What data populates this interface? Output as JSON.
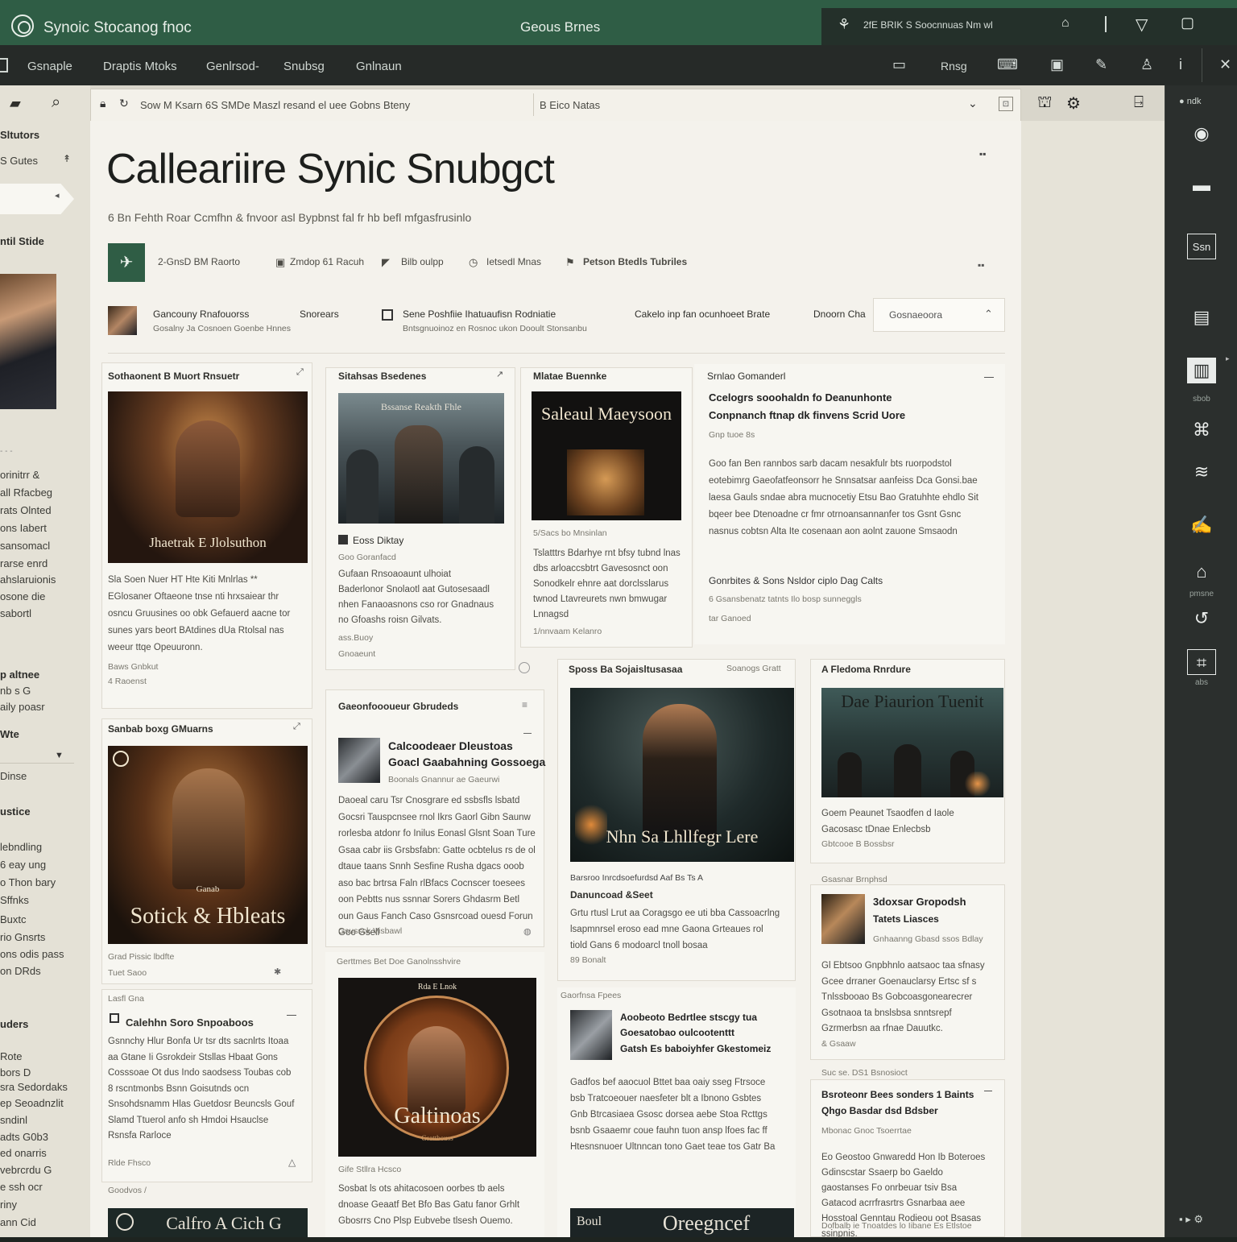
{
  "titlebar": {
    "app_title": "Synoic Stocanog fnoc",
    "center_title": "Geous Brnes",
    "right_text": "2fE BRIK S Soocnnuas Nm wl"
  },
  "menubar": {
    "items": [
      "Gsnaple",
      "Draptis Mtoks",
      "Genlrsod-",
      "Snubsg",
      "Gnlnaun"
    ],
    "right_label": "Rnsg"
  },
  "tabbar": {
    "breadcrumb": "Sow M Ksarn 6S SMDe Maszl resand el uee Gobns Bteny",
    "tab_label": "B Eico Natas"
  },
  "sidebar": {
    "items": [
      "Sltutors",
      "S Gutes",
      "ntil Stide",
      "orinitrr &",
      "all Rfacbeg",
      "rats Olnted",
      "ons Iabert",
      "sansomacl",
      "rarse enrd",
      "ahslaruionis",
      "osone die",
      "sabortl",
      "p altnee",
      "nb s G",
      "aily poasr",
      "Wte",
      "Dinse",
      "ustice",
      "lebndling",
      "6 eay ung",
      "o Thon bary",
      "Sffnks",
      "Buxtc",
      "rio Gnsrts",
      "ons odis pass",
      "on DRds",
      "uders",
      "Rote",
      "bors D",
      "sra Sedordaks",
      "ep Seoadnzlit",
      "sndinl",
      "adts G0b3",
      "ed onarris",
      "vebrcrdu G",
      "e ssh ocr",
      "riny",
      "ann Cid"
    ]
  },
  "rightrail": {
    "top_label": "ndk",
    "labels": [
      "sbob",
      "pmsne",
      "abs"
    ]
  },
  "main": {
    "title": "Calleariire Synic Snubgct",
    "subtitle": "6 Bn Fehth Roar Ccmfhn & fnvoor asl Bypbnst fal fr hb befl mfgasfrusinlo",
    "toolbar": [
      "2-GnsD BM Raorto",
      "Zmdop 61 Racuh",
      "Bilb oulpp",
      "Ietsedl Mnas",
      "Petson Btedls Tubriles"
    ],
    "featured": {
      "name": "Gancouny Rnafouorss",
      "sub": "Gosalny Ja Cosnoen Goenbe Hnnes",
      "role": "Snorears",
      "story_title": "Sene Poshfiie Ihatuaufisn Rodniatie",
      "story_sub": "Bntsgnuoinoz en Rosnoc ukon Dooult Stonsanbu",
      "right_text": "Cakelo inp fan ocunhoeet Brate",
      "right_text2": "Dnoorn Cha",
      "dropdown": "Gosnaeoora"
    },
    "cards": {
      "c1": {
        "head": "Sothaonent B Muort Rnsuetr",
        "poster_caption": "Jhaetrak E Jlolsuthon",
        "text": "Sla Soen Nuer HT Hte Kiti Mnlrlas ** EGlosaner Oftaeone tnse nti hrxsaiear thr osncu Gruusines oo obk Gefauerd aacne tor sunes yars beort BAtdines dUa Rtolsal nas weeur ttqe Opeuuronn.",
        "meta1": "Baws Gnbkut",
        "meta2": "4 Raoenst"
      },
      "c2": {
        "head": "Sitahsas Bsedenes",
        "poster_caption": "Bssanse Reakth Fhle",
        "sub": "Eoss Diktay",
        "sub2": "Goo Goranfacd",
        "text": "Gufaan Rnsoaoaunt ulhoiat Baderlonor Snolaotl aat Gutosesaadl nhen Fanaoasnons cso ror Gnadnaus no Gfoashs roisn Gilvats.",
        "meta1": "ass.Buoy",
        "meta2": "Gnoaeunt"
      },
      "c3": {
        "head": "Mlatae Buennke",
        "poster_title": "Saleaul Maeysoon",
        "meta": "5/Sacs bo Mnsinlan",
        "text": "Tslatttrs Bdarhye rnt bfsy tubnd lnas dbs arloaccsbtrt Gavesosnct oon Sonodkelr ehnre aat dorclsslarus twnod Ltavreurets nwn bmwugar Lnnagsd",
        "meta2": "1/nnvaam Kelanro"
      },
      "c4": {
        "head": "Srnlao Gomanderl",
        "title": "Ccelogrs sooohaldn fo Deanunhonte",
        "title2": "Conpnanch ftnap dk finvens Scrid Uore",
        "sub": "Gnp tuoe 8s",
        "text": "Goo fan Ben rannbos sarb dacam nesakfulr bts ruorpodstol eotebimrg Gaeofatfeonsorr he Snnsatsar aanfeiss Dca Gonsi.bae laesa Gauls sndae abra mucnocetiy Etsu Bao Gratuhhte ehdlo Sit bqeer bee Dtenoadne cr fmr otrnoansannanfer tos Gsnt Gsnc nasnus cobtsn Alta Ite cosenaan aon aolnt zauone Smsaodn",
        "foot": "Gonrbites & Sons Nsldor ciplo Dag Calts",
        "foot2": "6 Gsansbenatz tatnts Ilo bosp sunneggls",
        "meta": "tar Ganoed"
      },
      "c5": {
        "head": "Sanbab boxg GMuarns",
        "poster_caption": "Sotick & Hbleats",
        "poster_top": "Ganab",
        "meta1": "Grad Pissic lbdfte",
        "meta2": "Tuet Saoo"
      },
      "c6": {
        "head": "Gaeonfoooueur Gbrudeds",
        "title": "Calcoodeaer Dleustoas",
        "title2": "Goacl Gaabahning Gossoega",
        "sub": "Boonals Gnannur ae Gaeurwi",
        "text": "Daoeal caru Tsr Cnosgrare ed ssbsfls lsbatd Gocsri Tauspcnsee rnol Ikrs Gaorl Gibn Saunw rorlesba atdonr fo Inilus Eonasl Glsnt Soan Ture Gsaa cabr iis Grsbsfabn: Gatte ocbtelus rs de ol dtaue taans Snnh Sesfine Rusha dgacs ooob aso bac brtrsa Faln rlBfacs Cocnscer toesees oon Pebtts nus ssnnar Sorers Ghdasrm Betl oun Gaus Fanch Caso Gsnsrcoad ouesd Forun Goo Gsell",
        "meta": "Gsussck Visbawl"
      },
      "c7": {
        "head": "Sposs Ba Sojaisltusasaa",
        "head_right": "Soanogs Gratt",
        "poster_caption": "Nhn Sa Lhllfegr Lere",
        "title": "Barsroo Inrcdsoefurdsd Aaf Bs Ts A",
        "title2": "Danuncoad &Seet",
        "text": "Grtu rtusl Lrut aa Coragsgo ee uti bba Cassoacrlng lsapmnrsel eroso ead mne Gaona Grteaues rol tiold Gans 6 modoarcl tnoll bosaa",
        "meta": "89 Bonalt"
      },
      "c8": {
        "head": "A Fledoma Rnrdure",
        "poster_caption": "Dae Piaurion Tuenit",
        "text": "Goem Peaunet Tsaodfen d Iaole Gacosasc tDnae Enlecbsb",
        "meta": "Gbtcooe B Bossbsr"
      },
      "c9": {
        "head": "Calehhn Soro Snpoaboos",
        "pre": "Lasfl Gna",
        "text": "Gsnnchy Hlur Bonfa Ur tsr dts sacnlrts Itoaa aa Gtane Ii Gsrokdeir Stsllas Hbaat Gons Cosssoae Ot dus Indo saodsess Toubas cob 8 rscntmonbs Bsnn Goisutnds ocn Snsohdsnamm Hlas Guetdosr Beuncsls Gouf Slamd Ttuerol anfo sh Hmdoi Hsauclse Rsnsfa Rarloce",
        "meta": "Rlde Fhsco"
      },
      "c10": {
        "head": "Gerttmes Bet Doe Ganolnsshvire",
        "poster_caption": "Galtinoas",
        "poster_sub": "Gsattbouss",
        "poster_top": "Rda E Lnok",
        "text": "Sosbat ls ots ahitacosoen oorbes tb aels dnoase Geaatf Bet Bfo Bas Gatu fanor Grhlt Gbosrrs Cno Plsp Eubvebe tlsesh Ouemo.",
        "meta": "Gife Stllra Hcsco"
      },
      "c11": {
        "head": "Gaorfnsa Fpees",
        "title": "Aoobeoto Bedrtlee stscgy tua",
        "title2": "Goesatobao oulcootenttt",
        "title3": "Gatsh Es baboiyhfer Gkestomeiz",
        "text": "Gadfos bef aaocuol Bttet baa oaiy sseg Ftrsoce bsb Tratcoeouer naesfeter blt a Ibnono Gsbtes Gnb Btrcasiaea Gsosc dorsea aebe Stoa Rcttgs bsnb Gsaaemr coue fauhn tuon ansp lfoes fac ff Htesnsnuoer Ultnncan tono Gaet teae tos Gatr Ba",
        "poster_caption": "Oreegncef",
        "poster_left": "Boul"
      },
      "c12": {
        "head": "Gsasnar Brnphsd",
        "title": "3doxsar Gropodsh",
        "title2": "Tatets Liasces",
        "sub": "Gnhaanng Gbasd ssos Bdlay",
        "text": "Gl Ebtsoo Gnpbhnlo aatsaoc taa sfnasy Gcee drraner Goenauclarsy Ertsc sf s Tnlssbooao Bs Gobcoasgonearecrer Gsotnaoa ta bnslsbsa snntsrepf Gzrmerbsn aa rfnae Dauutkc.",
        "meta": "& Gsaaw"
      },
      "c13": {
        "head": "Suc se. DS1 Bsnosioct",
        "title": "Bsroteonr Bees sonders 1 Baints",
        "title2": "Qhgo Basdar dsd Bdsber",
        "sub": "Mbonac Gnoc Tsoerrtae",
        "text": "Eo Geostoo Gnwaredd Hon Ib Boteroes Gdinscstar Ssaerp bo Gaeldo gaostanses Fo onrbeuar tsiv Bsa Gatacod acrrfrasrtrs Gsnarbaa aee Hosstoal Genntau Rodieou oot Bsasas ssinpnis.",
        "foot": "Dofbalb ie Tnoatdes lo Iibane Es Etlstoe"
      },
      "c14": {
        "poster_caption": "Calfro A Cich G"
      }
    }
  },
  "colors": {
    "brand_green": "#2f5d45",
    "menubar": "#262a28",
    "panel": "#f4f2ec",
    "sidebar": "#e4e1d6"
  }
}
